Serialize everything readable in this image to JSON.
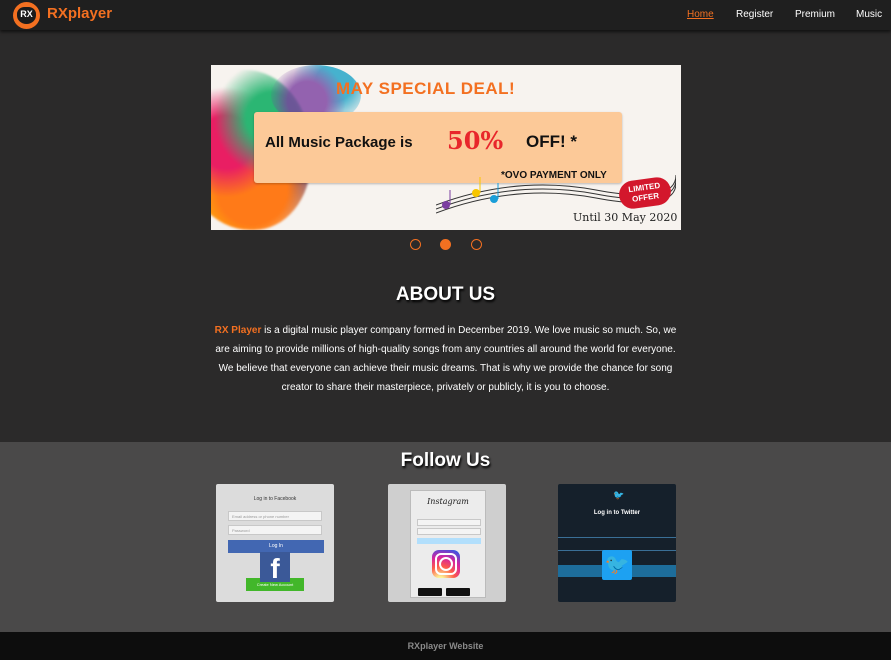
{
  "brand": {
    "name": "RXplayer",
    "logo_text": "RX"
  },
  "nav": {
    "items": [
      {
        "label": "Home",
        "active": true
      },
      {
        "label": "Register",
        "active": false
      },
      {
        "label": "Premium",
        "active": false
      },
      {
        "label": "Music",
        "active": false
      }
    ]
  },
  "carousel": {
    "slide": {
      "headline": "MAY SPECIAL DEAL!",
      "offer_prefix": "All Music Package is",
      "offer_percent": "50%",
      "offer_suffix": "OFF! *",
      "note": "*OVO PAYMENT ONLY",
      "badge": "LIMITED OFFER",
      "until": "Until 30 May 2020"
    },
    "active_index": 1,
    "count": 3
  },
  "about": {
    "title": "ABOUT US",
    "highlight": "RX Player",
    "body": " is a digital music player company formed in December 2019. We love music so much. So, we are aiming to provide millions of high-quality songs from any countries all around the world for everyone. We believe that everyone can achieve their music dreams. That is why we provide the chance for song creator to share their masterpiece, privately or publicly, it is you to choose."
  },
  "follow": {
    "title": "Follow Us",
    "facebook": {
      "heading": "Log in to Facebook",
      "email_placeholder": "Email address or phone number",
      "password_placeholder": "Password",
      "login_label": "Log In",
      "create_label": "Create New Account",
      "logo_glyph": "f"
    },
    "instagram": {
      "heading": "Instagram"
    },
    "twitter": {
      "heading": "Log in to Twitter",
      "logo_glyph": "🐦"
    }
  },
  "footer": {
    "text": "RXplayer Website"
  },
  "colors": {
    "accent": "#f37021",
    "background": "#2b2a2a",
    "follow_bg": "#4a4949",
    "footer_bg": "#0d0d0d"
  }
}
